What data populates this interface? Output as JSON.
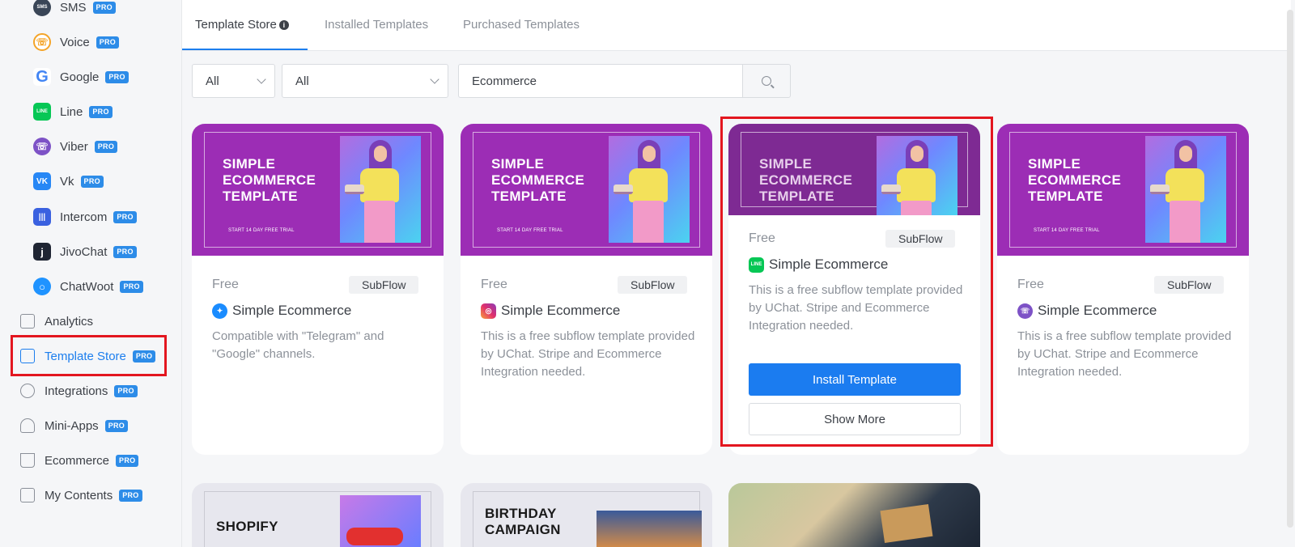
{
  "sidebar": {
    "channels": [
      {
        "label": "SMS",
        "badge": "PRO",
        "icon": "sms-icon",
        "color": "#3a4657",
        "glyph": "SMS"
      },
      {
        "label": "Voice",
        "badge": "PRO",
        "icon": "voice-icon",
        "color": "#f4a428",
        "glyph": "☏"
      },
      {
        "label": "Google",
        "badge": "PRO",
        "icon": "google-icon",
        "color": "#4285f4",
        "glyph": "G"
      },
      {
        "label": "Line",
        "badge": "PRO",
        "icon": "line-icon",
        "color": "#06c755",
        "glyph": "LINE"
      },
      {
        "label": "Viber",
        "badge": "PRO",
        "icon": "viber-icon",
        "color": "#7d52c6",
        "glyph": "☏"
      },
      {
        "label": "Vk",
        "badge": "PRO",
        "icon": "vk-icon",
        "color": "#2787f5",
        "glyph": "VK"
      },
      {
        "label": "Intercom",
        "badge": "PRO",
        "icon": "intercom-icon",
        "color": "#3a61e0",
        "glyph": "|||"
      },
      {
        "label": "JivoChat",
        "badge": "PRO",
        "icon": "jivochat-icon",
        "color": "#1f2533",
        "glyph": "j"
      },
      {
        "label": "ChatWoot",
        "badge": "PRO",
        "icon": "chatwoot-icon",
        "color": "#1f93ff",
        "glyph": "○"
      }
    ],
    "main_items": [
      {
        "label": "Analytics",
        "badge": "",
        "icon": "analytics-icon"
      },
      {
        "label": "Template Store",
        "badge": "PRO",
        "icon": "template-store-icon"
      },
      {
        "label": "Integrations",
        "badge": "PRO",
        "icon": "integrations-icon"
      },
      {
        "label": "Mini-Apps",
        "badge": "PRO",
        "icon": "mini-apps-icon"
      },
      {
        "label": "Ecommerce",
        "badge": "PRO",
        "icon": "ecommerce-icon"
      },
      {
        "label": "My Contents",
        "badge": "PRO",
        "icon": "my-contents-icon"
      }
    ],
    "active_item": "Template Store"
  },
  "tabs": [
    {
      "label": "Template Store",
      "active": true
    },
    {
      "label": "Installed Templates",
      "active": false
    },
    {
      "label": "Purchased Templates",
      "active": false
    }
  ],
  "filters": {
    "filter1": "All",
    "filter2": "All",
    "search_value": "Ecommerce"
  },
  "banner": {
    "title_line1": "SIMPLE",
    "title_line2": "ECOMMERCE",
    "title_line3": "TEMPLATE",
    "subtitle": "START 14 DAY FREE TRIAL"
  },
  "cards": [
    {
      "price": "Free",
      "type": "SubFlow",
      "title": "Simple Ecommerce",
      "channel_icon": "messenger-icon",
      "channel_color": "#1a8cff",
      "description": "Compatible with \"Telegram\" and \"Google\" channels."
    },
    {
      "price": "Free",
      "type": "SubFlow",
      "title": "Simple Ecommerce",
      "channel_icon": "instagram-icon",
      "channel_color": "#e1306c",
      "description": "This is a free subflow template provided by UChat. Stripe and Ecommerce Integration needed."
    },
    {
      "price": "Free",
      "type": "SubFlow",
      "title": "Simple Ecommerce",
      "channel_icon": "line-icon",
      "channel_color": "#06c755",
      "description": "This is a free subflow template provided by UChat. Stripe and Ecommerce Integration needed.",
      "install_label": "Install Template",
      "more_label": "Show More"
    },
    {
      "price": "Free",
      "type": "SubFlow",
      "title": "Simple Ecommerce",
      "channel_icon": "viber-icon",
      "channel_color": "#7d52c6",
      "description": "This is a free subflow template provided by UChat. Stripe and Ecommerce Integration needed."
    }
  ],
  "bottom_cards": [
    {
      "title": "SHOPIFY"
    },
    {
      "title_line1": "BIRTHDAY",
      "title_line2": "CAMPAIGN"
    }
  ]
}
